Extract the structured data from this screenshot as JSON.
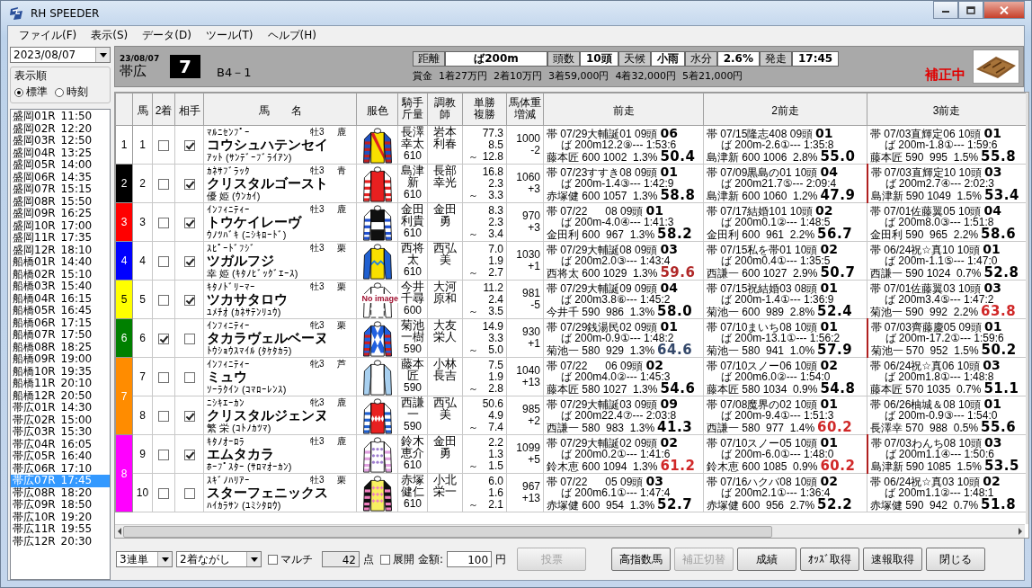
{
  "window": {
    "title": "RH SPEEDER"
  },
  "menu": [
    "ファイル(F)",
    "表示(S)",
    "データ(D)",
    "ツール(T)",
    "ヘルプ(H)"
  ],
  "sidebar": {
    "date": "2023/08/07",
    "order": {
      "label": "表示順",
      "options": [
        {
          "label": "標準",
          "selected": true
        },
        {
          "label": "時刻",
          "selected": false
        }
      ]
    },
    "races": [
      {
        "race": "盛岡01R",
        "time": "11:50",
        "selected": false
      },
      {
        "race": "盛岡02R",
        "time": "12:20",
        "selected": false
      },
      {
        "race": "盛岡03R",
        "time": "12:50",
        "selected": false
      },
      {
        "race": "盛岡04R",
        "time": "13:25",
        "selected": false
      },
      {
        "race": "盛岡05R",
        "time": "14:00",
        "selected": false
      },
      {
        "race": "盛岡06R",
        "time": "14:35",
        "selected": false
      },
      {
        "race": "盛岡07R",
        "time": "15:15",
        "selected": false
      },
      {
        "race": "盛岡08R",
        "time": "15:50",
        "selected": false
      },
      {
        "race": "盛岡09R",
        "time": "16:25",
        "selected": false
      },
      {
        "race": "盛岡10R",
        "time": "17:00",
        "selected": false
      },
      {
        "race": "盛岡11R",
        "time": "17:35",
        "selected": false
      },
      {
        "race": "盛岡12R",
        "time": "18:10",
        "selected": false
      },
      {
        "race": "船橋01R",
        "time": "14:40",
        "selected": false
      },
      {
        "race": "船橋02R",
        "time": "15:10",
        "selected": false
      },
      {
        "race": "船橋03R",
        "time": "15:40",
        "selected": false
      },
      {
        "race": "船橋04R",
        "time": "16:15",
        "selected": false
      },
      {
        "race": "船橋05R",
        "time": "16:45",
        "selected": false
      },
      {
        "race": "船橋06R",
        "time": "17:15",
        "selected": false
      },
      {
        "race": "船橋07R",
        "time": "17:50",
        "selected": false
      },
      {
        "race": "船橋08R",
        "time": "18:25",
        "selected": false
      },
      {
        "race": "船橋09R",
        "time": "19:00",
        "selected": false
      },
      {
        "race": "船橋10R",
        "time": "19:35",
        "selected": false
      },
      {
        "race": "船橋11R",
        "time": "20:10",
        "selected": false
      },
      {
        "race": "船橋12R",
        "time": "20:50",
        "selected": false
      },
      {
        "race": "帯広01R",
        "time": "14:30",
        "selected": false
      },
      {
        "race": "帯広02R",
        "time": "15:00",
        "selected": false
      },
      {
        "race": "帯広03R",
        "time": "15:30",
        "selected": false
      },
      {
        "race": "帯広04R",
        "time": "16:05",
        "selected": false
      },
      {
        "race": "帯広05R",
        "time": "16:40",
        "selected": false
      },
      {
        "race": "帯広06R",
        "time": "17:10",
        "selected": false
      },
      {
        "race": "帯広07R",
        "time": "17:45",
        "selected": true
      },
      {
        "race": "帯広08R",
        "time": "18:20",
        "selected": false
      },
      {
        "race": "帯広09R",
        "time": "18:50",
        "selected": false
      },
      {
        "race": "帯広10R",
        "time": "19:20",
        "selected": false
      },
      {
        "race": "帯広11R",
        "time": "19:55",
        "selected": false
      },
      {
        "race": "帯広12R",
        "time": "20:30",
        "selected": false
      }
    ]
  },
  "race": {
    "date": "23/08/07",
    "venue": "帯広",
    "number": "7",
    "class": "B4－1",
    "info": [
      {
        "label": "距離",
        "value": "ば200m"
      },
      {
        "label": "頭数",
        "value": "10頭"
      },
      {
        "label": "天候",
        "value": "小雨"
      },
      {
        "label": "水分",
        "value": "2.6%"
      },
      {
        "label": "発走",
        "value": "17:45"
      }
    ],
    "prize_label": "賞金",
    "prizes": [
      "1着27万円",
      "2着10万円",
      "3着59,000円",
      "4着32,000円",
      "5着21,000円"
    ],
    "status": "補正中"
  },
  "table": {
    "columns": [
      {
        "lines": [
          "馬"
        ]
      },
      {
        "lines": [
          "2着"
        ]
      },
      {
        "lines": [
          "相手"
        ]
      },
      {
        "lines": [
          "馬　　名"
        ]
      },
      {
        "lines": [
          "服色"
        ]
      },
      {
        "lines": [
          "騎手",
          "斤量"
        ]
      },
      {
        "lines": [
          "調教",
          "師"
        ]
      },
      {
        "lines": [
          "単勝",
          "複勝"
        ]
      },
      {
        "lines": [
          "馬体重",
          "増減"
        ]
      },
      {
        "lines": [
          "前走"
        ]
      },
      {
        "lines": [
          "2前走"
        ]
      },
      {
        "lines": [
          "3前走"
        ]
      }
    ],
    "frames": [
      {
        "number": "1",
        "color": "#ffffff",
        "horses": [
          {
            "number": "1",
            "second": false,
            "partner": true,
            "sire": "ﾏﾙﾆｾﾝﾌﾟｰ",
            "sex": "牡3",
            "coat": "鹿",
            "name": "コウシュハテンセイ",
            "dam": "ｱｯﾄ (ｻﾝﾃﾞｰﾌﾞﾗｲｱﾝ)",
            "silks": {
              "kind": "sash",
              "color": "#f8e000"
            },
            "jockey": [
              "長澤",
              "幸太"
            ],
            "weight": "610",
            "trainer": [
              "岩本",
              "利春"
            ],
            "odds": [
              "77.3",
              "8.5",
              "12.8"
            ],
            "range_mark": "～",
            "body_weight": "1000",
            "weight_change": "-2",
            "past": [
              {
                "line1": "帯 07/29大輔誕01 09頭",
                "place": "06",
                "line2": "ば 200m12.2⑨--- 1:53:6",
                "line3": "藤本匠 600 1002  1.3%",
                "index": "50.4",
                "color": "#000000",
                "marked": false
              },
              {
                "line1": "帯 07/15隆志408 09頭",
                "place": "01",
                "line2": "ば 200m-2.6①--- 1:35:8",
                "line3": "島津新 600 1006  2.8%",
                "index": "55.0",
                "color": "#000000",
                "marked": false
              },
              {
                "line1": "帯 07/03直輝定06 10頭",
                "place": "01",
                "line2": "ば 200m-1.8①--- 1:59:6",
                "line3": "藤本匠 590  995  1.5%",
                "index": "55.8",
                "color": "#000000",
                "marked": false
              }
            ]
          }
        ]
      },
      {
        "number": "2",
        "color": "#000000",
        "horses": [
          {
            "number": "2",
            "second": false,
            "partner": true,
            "sire": "ｶﾈｻﾌﾞﾗｯｸ",
            "sex": "牡3",
            "coat": "青",
            "name": "クリスタルゴースト",
            "dam": "優 姫 (ｳﾝｶｲ)",
            "silks": {
              "kind": "hoops",
              "color": "#e82020"
            },
            "jockey": [
              "島津",
              "新"
            ],
            "weight": "610",
            "trainer": [
              "長部",
              "幸光"
            ],
            "odds": [
              "16.8",
              "2.3",
              "3.3"
            ],
            "range_mark": "～",
            "body_weight": "1060",
            "weight_change": "+3",
            "past": [
              {
                "line1": "帯 07/23すすき08 09頭",
                "place": "01",
                "line2": "ば 200m-1.4③--- 1:42:9",
                "line3": "赤塚健 600 1057  1.3%",
                "index": "58.8",
                "color": "#000000",
                "marked": false
              },
              {
                "line1": "帯 07/09黒島の01 10頭",
                "place": "04",
                "line2": "ば 200m21.7⑤--- 2:09:4",
                "line3": "島津新 600 1060  1.2%",
                "index": "47.9",
                "color": "#000000",
                "marked": false
              },
              {
                "line1": "帯 07/03直輝定10 10頭",
                "place": "03",
                "line2": "ば 200m2.7④--- 2:02:3",
                "line3": "島津新 590 1049  1.5%",
                "index": "53.4",
                "color": "#000000",
                "marked": true
              }
            ]
          }
        ]
      },
      {
        "number": "3",
        "color": "#ff0000",
        "horses": [
          {
            "number": "3",
            "second": false,
            "partner": true,
            "sire": "ｲﾝﾌｨﾆﾃｨｰ",
            "sex": "牡3",
            "coat": "鹿",
            "name": "トウケイレーヴ",
            "dam": "ｳﾉﾂﾊﾞｷ (ﾆｼｷﾛｰﾄﾞ)",
            "silks": {
              "kind": "band",
              "color": "#101010"
            },
            "jockey": [
              "金田",
              "利貴"
            ],
            "weight": "610",
            "trainer": [
              "金田",
              "勇"
            ],
            "odds": [
              "8.3",
              "2.3",
              "3.4"
            ],
            "range_mark": "～",
            "body_weight": "970",
            "weight_change": "+3",
            "past": [
              {
                "line1": "帯 07/22      08 09頭",
                "place": "01",
                "line2": "ば 200m-4.0④--- 1:41:3",
                "line3": "金田利 600  967  1.3%",
                "index": "58.2",
                "color": "#000000",
                "marked": false
              },
              {
                "line1": "帯 07/17結婚101 10頭",
                "place": "02",
                "line2": "ば 200m0.1②--- 1:48:5",
                "line3": "金田利 600  961  2.2%",
                "index": "56.7",
                "color": "#000000",
                "marked": false
              },
              {
                "line1": "帯 07/01佐藤翼05 10頭",
                "place": "04",
                "line2": "ば 200m8.0③--- 1:51:8",
                "line3": "金田利 590  965  2.2%",
                "index": "58.6",
                "color": "#000000",
                "marked": false
              }
            ]
          }
        ]
      },
      {
        "number": "4",
        "color": "#0000ff",
        "horses": [
          {
            "number": "4",
            "second": false,
            "partner": true,
            "sire": "ｽﾋﾟｰﾄﾞﾌｼﾞ",
            "sex": "牡3",
            "coat": "栗",
            "name": "ツガルフジ",
            "dam": "幸 姫 (ｷﾀﾉﾋﾞｯｸﾞｴｰｽ)",
            "silks": {
              "kind": "zigzag",
              "color": "#f8e000"
            },
            "jockey": [
              "西将",
              "太"
            ],
            "weight": "610",
            "trainer": [
              "西弘",
              "美"
            ],
            "odds": [
              "7.0",
              "1.9",
              "2.7"
            ],
            "range_mark": "～",
            "body_weight": "1030",
            "weight_change": "+1",
            "past": [
              {
                "line1": "帯 07/29大輔誕08 09頭",
                "place": "03",
                "line2": "ば 200m2.0③--- 1:43:4",
                "line3": "西将太 600 1029  1.3%",
                "index": "59.6",
                "color": "#b02828",
                "marked": false
              },
              {
                "line1": "帯 07/15私を帯01 10頭",
                "place": "02",
                "line2": "ば 200m0.4①--- 1:35:5",
                "line3": "西謙一 600 1027  2.9%",
                "index": "50.7",
                "color": "#000000",
                "marked": false
              },
              {
                "line1": "帯 06/24祝☆真10 10頭",
                "place": "01",
                "line2": "ば 200m-1.1⑤--- 1:47:0",
                "line3": "西謙一 590 1024  0.7%",
                "index": "52.8",
                "color": "#000000",
                "marked": false
              }
            ]
          }
        ]
      },
      {
        "number": "5",
        "color": "#ffff00",
        "horses": [
          {
            "number": "5",
            "second": false,
            "partner": true,
            "sire": "ｷﾀﾉﾄﾞﾘｰﾏｰ",
            "sex": "牡3",
            "coat": "栗",
            "name": "ツカサタロウ",
            "dam": "ﾕﾒﾁｵ (ｶﾈｻﾃﾝﾘｭｳ)",
            "silks": {
              "kind": "none",
              "label": "No image"
            },
            "jockey": [
              "今井",
              "千尋"
            ],
            "weight": "600",
            "trainer": [
              "大河",
              "原和"
            ],
            "odds": [
              "11.2",
              "2.4",
              "3.5"
            ],
            "range_mark": "～",
            "body_weight": "981",
            "weight_change": "-5",
            "past": [
              {
                "line1": "帯 07/29大輔誕09 09頭",
                "place": "04",
                "line2": "ば 200m3.8⑥--- 1:45:2",
                "line3": "今井千 590  986  1.3%",
                "index": "58.0",
                "color": "#000000",
                "marked": false
              },
              {
                "line1": "帯 07/15祝結婚03 08頭",
                "place": "01",
                "line2": "ば 200m-1.4①--- 1:36:9",
                "line3": "菊池一 600  989  2.8%",
                "index": "52.4",
                "color": "#000000",
                "marked": false
              },
              {
                "line1": "帯 07/01佐藤翼03 10頭",
                "place": "03",
                "line2": "ば 200m3.4⑤--- 1:47:2",
                "line3": "菊池一 590  992  2.2%",
                "index": "63.8",
                "color": "#d02828",
                "marked": false
              }
            ]
          }
        ]
      },
      {
        "number": "6",
        "color": "#008000",
        "horses": [
          {
            "number": "6",
            "second": true,
            "partner": false,
            "sire": "ｲﾝﾌｨﾆﾃｨｰ",
            "sex": "牝3",
            "coat": "栗",
            "name": "タカラヴェルベーヌ",
            "dam": "ﾄｳｼｮｳｽﾏｲﾙ (ﾀｹﾀｶﾗ)",
            "silks": {
              "kind": "cross"
            },
            "jockey": [
              "菊池",
              "一樹"
            ],
            "weight": "590",
            "trainer": [
              "大友",
              "栄人"
            ],
            "odds": [
              "14.9",
              "3.3",
              "5.0"
            ],
            "range_mark": "～",
            "body_weight": "930",
            "weight_change": "+1",
            "past": [
              {
                "line1": "帯 07/29銭湯民02 09頭",
                "place": "01",
                "line2": "ば 200m-0.9①--- 1:48:2",
                "line3": "菊池一 580  929  1.3%",
                "index": "64.6",
                "color": "#34486a",
                "marked": false
              },
              {
                "line1": "帯 07/10まいち08 10頭",
                "place": "01",
                "line2": "ば 200m-13.1①--- 1:56:2",
                "line3": "菊池一 580  941  1.0%",
                "index": "57.9",
                "color": "#000000",
                "marked": false
              },
              {
                "line1": "帯 07/03齊藤慶05 09頭",
                "place": "01",
                "line2": "ば 200m-17.2①--- 1:59:6",
                "line3": "菊池一 570  952  1.5%",
                "index": "50.2",
                "color": "#000000",
                "marked": true
              }
            ]
          }
        ]
      },
      {
        "number": "7",
        "color": "#ff8c00",
        "horses": [
          {
            "number": "7",
            "second": false,
            "partner": false,
            "sire": "ｲﾝﾌｨﾆﾃｨｰ",
            "sex": "牝3",
            "coat": "芦",
            "name": "ミュウ",
            "dam": "ｿｰﾗｸｲﾝ (ｺﾏﾛｰﾚﾝｽ)",
            "silks": {
              "kind": "plain"
            },
            "jockey": [
              "藤本",
              "匠"
            ],
            "weight": "590",
            "trainer": [
              "小林",
              "長吉"
            ],
            "odds": [
              "7.5",
              "1.9",
              "2.8"
            ],
            "range_mark": "～",
            "body_weight": "1040",
            "weight_change": "+13",
            "past": [
              {
                "line1": "帯 07/22      06 09頭",
                "place": "02",
                "line2": "ば 200m4.0②--- 1:45:3",
                "line3": "藤本匠 580 1027  1.3%",
                "index": "54.6",
                "color": "#000000",
                "marked": false
              },
              {
                "line1": "帯 07/10スノー06 10頭",
                "place": "02",
                "line2": "ば 200m6.0②--- 1:54:0",
                "line3": "藤本匠 580 1034  0.9%",
                "index": "54.8",
                "color": "#000000",
                "marked": false
              },
              {
                "line1": "帯 06/24祝☆真06 10頭",
                "place": "03",
                "line2": "ば 200m1.8①--- 1:48:8",
                "line3": "藤本匠 570 1035  0.7%",
                "index": "51.1",
                "color": "#000000",
                "marked": false
              }
            ]
          },
          {
            "number": "8",
            "second": false,
            "partner": true,
            "sire": "ﾆｼｷｴｰｶﾝ",
            "sex": "牝3",
            "coat": "鹿",
            "name": "クリスタルジェンヌ",
            "dam": "繁 栄 (ｺﾄﾉｶﾂﾏ)",
            "silks": {
              "kind": "diamonds",
              "color": "#e82020"
            },
            "jockey": [
              "西謙",
              "一"
            ],
            "weight": "590",
            "trainer": [
              "西弘",
              "美"
            ],
            "odds": [
              "50.6",
              "4.9",
              "7.4"
            ],
            "range_mark": "～",
            "body_weight": "985",
            "weight_change": "+2",
            "past": [
              {
                "line1": "帯 07/29大輔誕03 09頭",
                "place": "09",
                "line2": "ば 200m22.4⑦--- 2:03:8",
                "line3": "西謙一 580  983  1.3%",
                "index": "41.3",
                "color": "#000000",
                "marked": false
              },
              {
                "line1": "帯 07/08魔界の02 10頭",
                "place": "01",
                "line2": "ば 200m-9.4①--- 1:51:3",
                "line3": "西謙一 580  977  1.4%",
                "index": "60.2",
                "color": "#d02828",
                "marked": false
              },
              {
                "line1": "帯 06/26柚城＆08 10頭",
                "place": "01",
                "line2": "ば 200m-0.9③--- 1:54:0",
                "line3": "長澤幸 570  988  0.5%",
                "index": "55.6",
                "color": "#000000",
                "marked": false
              }
            ]
          }
        ]
      },
      {
        "number": "8",
        "color": "#ff00ff",
        "horses": [
          {
            "number": "9",
            "second": false,
            "partner": true,
            "sire": "ｷﾀﾉｵｰﾛﾗ",
            "sex": "牡3",
            "coat": "鹿",
            "name": "エムタカラ",
            "dam": "ﾎｰﾌﾟｽﾀｰ (ｻﾛﾏｵｰｶﾝ)",
            "silks": {
              "kind": "dots"
            },
            "jockey": [
              "鈴木",
              "恵介"
            ],
            "weight": "610",
            "trainer": [
              "金田",
              "勇"
            ],
            "odds": [
              "2.2",
              "1.3",
              "1.5"
            ],
            "range_mark": "～",
            "body_weight": "1099",
            "weight_change": "+5",
            "past": [
              {
                "line1": "帯 07/29大輔誕02 09頭",
                "place": "02",
                "line2": "ば 200m0.2①--- 1:41:6",
                "line3": "鈴木恵 600 1094  1.3%",
                "index": "61.2",
                "color": "#d02828",
                "marked": false
              },
              {
                "line1": "帯 07/10スノー05 10頭",
                "place": "01",
                "line2": "ば 200m-6.0①--- 1:48:0",
                "line3": "鈴木恵 600 1085  0.9%",
                "index": "60.2",
                "color": "#d02828",
                "marked": false
              },
              {
                "line1": "帯 07/03わんち08 10頭",
                "place": "03",
                "line2": "ば 200m1.1④--- 1:50:6",
                "line3": "島津新 590 1085  1.5%",
                "index": "53.5",
                "color": "#000000",
                "marked": true
              }
            ]
          },
          {
            "number": "10",
            "second": false,
            "partner": false,
            "sire": "ｽｷﾞﾉﾊﾘｱｰ",
            "sex": "牡3",
            "coat": "栗",
            "name": "スターフェニックス",
            "dam": "ﾊｲｶﾗｻﾝ (ﾕﾐｼﾀﾛｳ)",
            "silks": {
              "kind": "stars",
              "color": "#f8f060"
            },
            "jockey": [
              "赤塚",
              "健仁"
            ],
            "weight": "610",
            "trainer": [
              "小北",
              "栄一"
            ],
            "odds": [
              "6.0",
              "1.6",
              "2.1"
            ],
            "range_mark": "～",
            "body_weight": "967",
            "weight_change": "+13",
            "past": [
              {
                "line1": "帯 07/22      05 09頭",
                "place": "03",
                "line2": "ば 200m6.1①--- 1:47:4",
                "line3": "赤塚健 600  954  1.3%",
                "index": "52.7",
                "color": "#000000",
                "marked": false
              },
              {
                "line1": "帯 07/16ハクバ08 10頭",
                "place": "02",
                "line2": "ば 200m2.1①--- 1:36:4",
                "line3": "赤塚健 600  956  2.7%",
                "index": "52.2",
                "color": "#000000",
                "marked": false
              },
              {
                "line1": "帯 06/24祝☆真03 10頭",
                "place": "02",
                "line2": "ば 200m1.1②--- 1:48:1",
                "line3": "赤塚健 590  942  0.7%",
                "index": "51.8",
                "color": "#000000",
                "marked": false
              }
            ]
          }
        ]
      }
    ]
  },
  "footer": {
    "bet_type": "3連単",
    "method": "2着ながし",
    "multi": {
      "label": "マルチ",
      "checked": false
    },
    "points": "42",
    "points_unit": "点",
    "expand": {
      "label": "展開",
      "checked": false
    },
    "amount_label": "金額:",
    "amount": "100",
    "amount_unit": "円",
    "buttons": [
      {
        "label": "投票",
        "disabled": true
      },
      {
        "label": "高指数馬",
        "disabled": false
      },
      {
        "label": "補正切替",
        "disabled": true
      },
      {
        "label": "成績",
        "disabled": false
      },
      {
        "label": "ｵｯｽﾞ取得",
        "disabled": false
      },
      {
        "label": "速報取得",
        "disabled": false
      },
      {
        "label": "閉じる",
        "disabled": false
      }
    ]
  }
}
